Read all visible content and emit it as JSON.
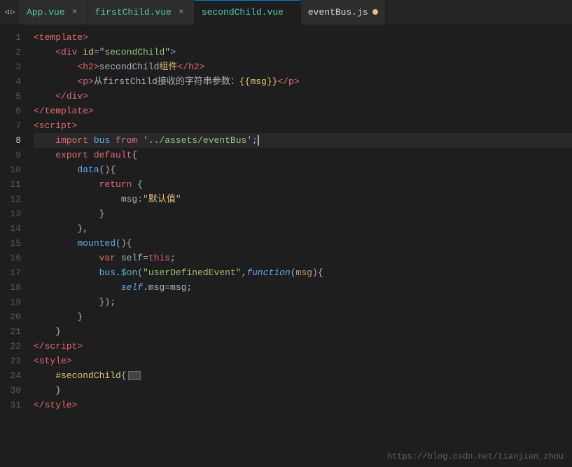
{
  "tabs": [
    {
      "label": "App.vue",
      "active": false,
      "modified": false,
      "closable": true
    },
    {
      "label": "firstChild.vue",
      "active": false,
      "modified": false,
      "closable": true
    },
    {
      "label": "secondChild.vue",
      "active": true,
      "modified": false,
      "closable": false,
      "dot": false
    },
    {
      "label": "eventBus.js",
      "active": false,
      "modified": true,
      "closable": false,
      "dot": true
    }
  ],
  "watermark": "https://blog.csdn.net/tianjian_zhou",
  "active_line": 8,
  "lines": [
    {
      "num": 1,
      "content": "template_open"
    },
    {
      "num": 2,
      "content": "div_open"
    },
    {
      "num": 3,
      "content": "h2_content"
    },
    {
      "num": 4,
      "content": "p_content"
    },
    {
      "num": 5,
      "content": "div_close"
    },
    {
      "num": 6,
      "content": "template_close"
    },
    {
      "num": 7,
      "content": "script_open"
    },
    {
      "num": 8,
      "content": "import_line"
    },
    {
      "num": 9,
      "content": "export_default"
    },
    {
      "num": 10,
      "content": "data_func"
    },
    {
      "num": 11,
      "content": "return_open"
    },
    {
      "num": 12,
      "content": "msg_default"
    },
    {
      "num": 13,
      "content": "brace_close_1"
    },
    {
      "num": 14,
      "content": "comma_close"
    },
    {
      "num": 15,
      "content": "mounted_func"
    },
    {
      "num": 16,
      "content": "var_self"
    },
    {
      "num": 17,
      "content": "bus_on"
    },
    {
      "num": 18,
      "content": "self_msg"
    },
    {
      "num": 19,
      "content": "bracket_close"
    },
    {
      "num": 20,
      "content": "brace_close_2"
    },
    {
      "num": 21,
      "content": "brace_close_3"
    },
    {
      "num": 22,
      "content": "script_close"
    },
    {
      "num": 23,
      "content": "style_open"
    },
    {
      "num": 24,
      "content": "id_selector"
    },
    {
      "num": 30,
      "content": "style_brace_close"
    },
    {
      "num": 31,
      "content": "style_close"
    }
  ]
}
